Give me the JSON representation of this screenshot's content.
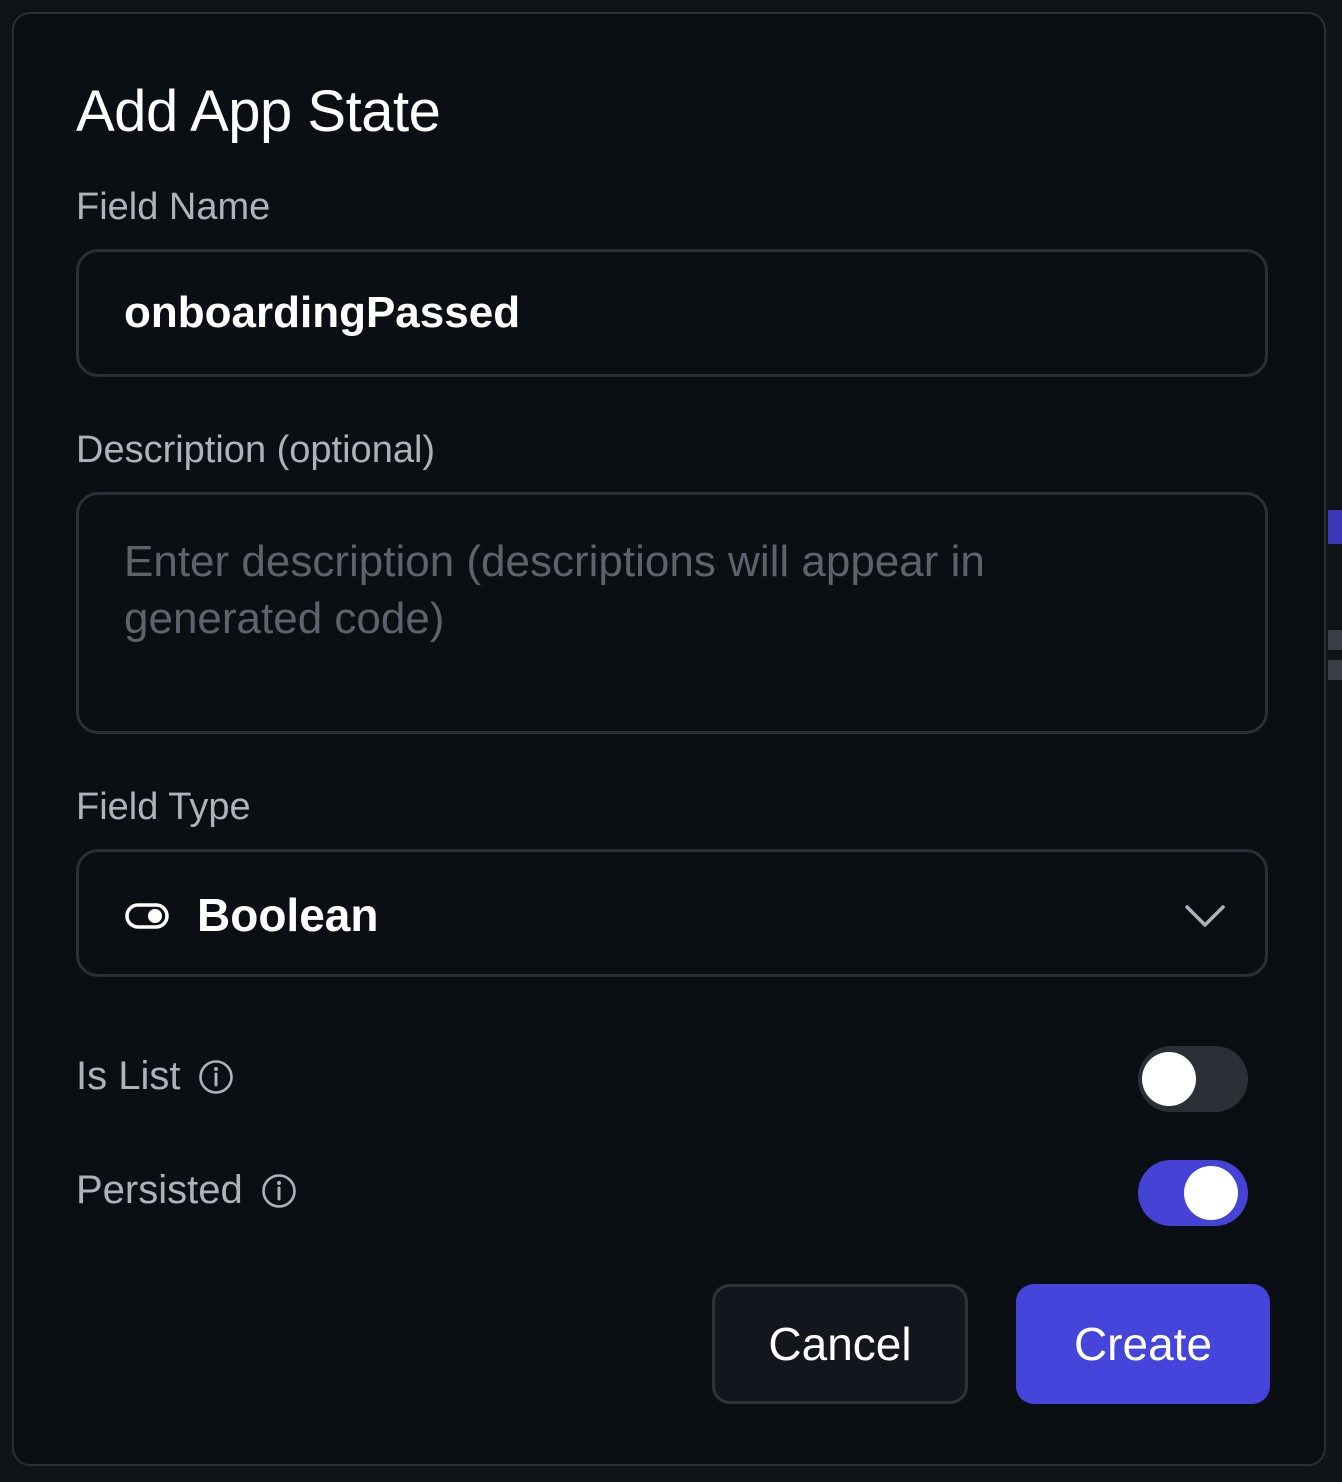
{
  "dialog": {
    "title": "Add App State",
    "field_name": {
      "label": "Field Name",
      "value": "onboardingPassed"
    },
    "description": {
      "label": "Description (optional)",
      "placeholder": "Enter description (descriptions will appear in generated code)",
      "value": ""
    },
    "field_type": {
      "label": "Field Type",
      "selected": "Boolean",
      "icon": "toggle-icon"
    },
    "is_list": {
      "label": "Is List",
      "enabled": false
    },
    "persisted": {
      "label": "Persisted",
      "enabled": true
    },
    "buttons": {
      "cancel": "Cancel",
      "create": "Create"
    }
  },
  "colors": {
    "accent": "#4545dc",
    "background": "#0b0f14",
    "border": "#2b2f36",
    "label": "#aeb3bb",
    "placeholder": "#5d626b"
  }
}
